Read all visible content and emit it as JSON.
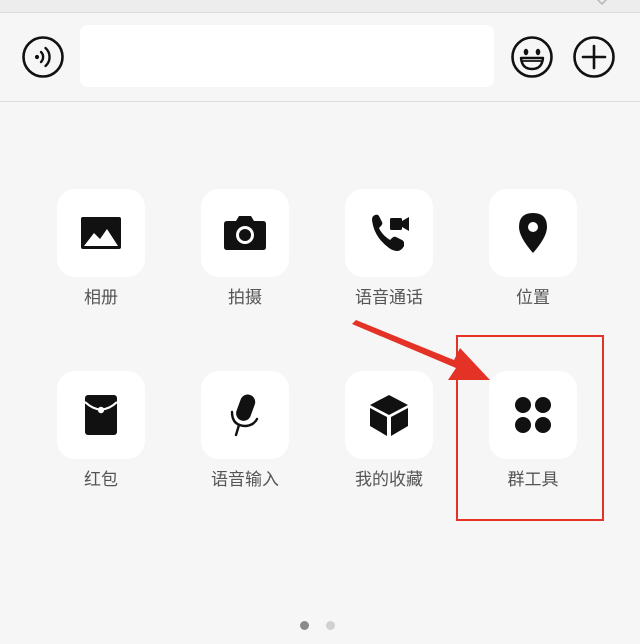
{
  "input_bar": {
    "text_value": "",
    "voice_icon": "voice-wave-icon",
    "emoji_icon": "smiley-face-icon",
    "more_icon": "plus-circle-icon"
  },
  "panel": {
    "rows": [
      [
        {
          "label": "相册",
          "icon": "photo-album-icon"
        },
        {
          "label": "拍摄",
          "icon": "camera-icon"
        },
        {
          "label": "语音通话",
          "icon": "voice-video-call-icon"
        },
        {
          "label": "位置",
          "icon": "location-pin-icon"
        }
      ],
      [
        {
          "label": "红包",
          "icon": "red-envelope-icon"
        },
        {
          "label": "语音输入",
          "icon": "microphone-icon"
        },
        {
          "label": "我的收藏",
          "icon": "favorites-cube-icon"
        },
        {
          "label": "群工具",
          "icon": "group-tools-grid-icon"
        }
      ]
    ],
    "current_page": 1,
    "page_count": 2
  },
  "annotation": {
    "color": "#e53227",
    "highlighted": "群工具"
  },
  "colors": {
    "background": "#f6f6f6",
    "tile": "#ffffff",
    "icon": "#111111",
    "label": "#555555"
  }
}
